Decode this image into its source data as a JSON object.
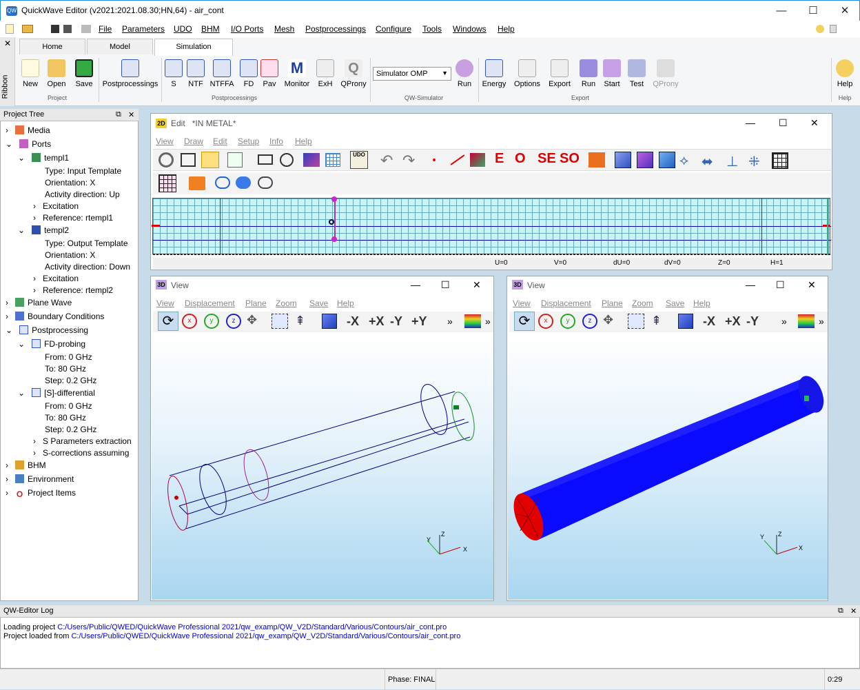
{
  "app": {
    "title": "QuickWave Editor (v2021:2021.08.30;HN,64) - air_cont"
  },
  "menu": [
    "File",
    "Parameters",
    "UDO",
    "BHM",
    "I/O Ports",
    "Mesh",
    "Postprocessings",
    "Configure",
    "Tools",
    "Windows",
    "Help"
  ],
  "ribbon": {
    "side": "Ribbon",
    "tabs": [
      "Home",
      "Model",
      "Simulation"
    ],
    "project": [
      "New",
      "Open",
      "Save"
    ],
    "project_label": "Project",
    "postprocess": "Postprocessings",
    "post_items": [
      "S",
      "NTF",
      "NTFFA",
      "FD",
      "Pav",
      "Monitor",
      "ExH",
      "QProny"
    ],
    "post_label": "Postprocessings",
    "simulator": "Simulator OMP",
    "sim_label": "QW-Simulator",
    "sim_run": "Run",
    "export_items": [
      "Energy",
      "Options",
      "Export",
      "Run",
      "Start",
      "Test",
      "QProny"
    ],
    "export_label": "Export",
    "help": "Help",
    "help_label": "Help"
  },
  "tree": {
    "title": "Project Tree",
    "items": [
      "Media",
      "Ports",
      "templ1",
      "Type: Input Template",
      "Orientation: X",
      "Activity direction: Up",
      "Excitation",
      "Reference: rtempl1",
      "templ2",
      "Type: Output Template",
      "Orientation: X",
      "Activity direction: Down",
      "Excitation",
      "Reference: rtempl2",
      "Plane Wave",
      "Boundary Conditions",
      "Postprocessing",
      "FD-probing",
      "From: 0 GHz",
      "To: 80 GHz",
      "Step: 0.2 GHz",
      "[S]-differential",
      "From: 0 GHz",
      "To: 80 GHz",
      "Step: 0.2 GHz",
      "S Parameters extraction",
      "S-corrections assuming",
      "BHM",
      "Environment",
      "Project Items"
    ]
  },
  "edit": {
    "title": "Edit",
    "subtitle": "*IN METAL*",
    "badge": "2D",
    "menu": [
      "View",
      "Draw",
      "Edit",
      "Setup",
      "Info",
      "Help"
    ],
    "tool_e": "E",
    "tool_o": "O",
    "tool_se": "SE",
    "tool_so": "SO",
    "status": [
      "U=0",
      "V=0",
      "dU=0",
      "dV=0",
      "Z=0",
      "H=1"
    ]
  },
  "view1": {
    "title": "View",
    "badge": "3D",
    "menu": [
      "View",
      "Displacement",
      "Plane",
      "Zoom",
      "Save",
      "Help"
    ],
    "nav": [
      "-X",
      "+X",
      "-Y",
      "+Y"
    ],
    "more": "»",
    "axes": [
      "Y",
      "Z",
      "X"
    ]
  },
  "view2": {
    "title": "View",
    "badge": "3D",
    "menu": [
      "View",
      "Displacement",
      "Plane",
      "Zoom",
      "Save",
      "Help"
    ],
    "nav": [
      "-X",
      "+X",
      "-Y"
    ],
    "more": "»",
    "axes": [
      "Y",
      "Z",
      "X"
    ]
  },
  "log": {
    "title": "QW-Editor Log",
    "lines": [
      {
        "prefix": "Loading project ",
        "path": "C:/Users/Public/QWED/QuickWave Professional 2021/qw_examp/QW_V2D/Standard/Various/Contours/air_cont.pro"
      },
      {
        "prefix": "Project loaded from ",
        "path": "C:/Users/Public/QWED/QuickWave Professional 2021/qw_examp/QW_V2D/Standard/Various/Contours/air_cont.pro"
      }
    ]
  },
  "status": {
    "phase": "Phase: FINAL",
    "time": "0:29"
  },
  "colors": {
    "accent": "#1e88e5",
    "mesh": "#c8f4f4",
    "cylinder": "#0a0aff",
    "link": "#0000c8"
  }
}
